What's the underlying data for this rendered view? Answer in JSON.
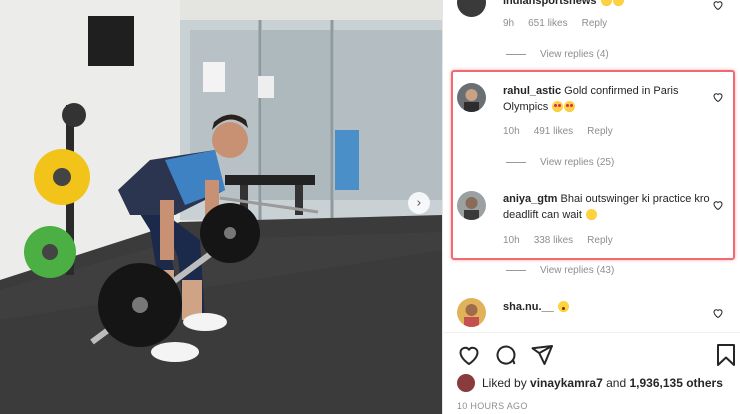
{
  "comments": [
    {
      "username": "indiansportsnews",
      "text": "",
      "emojis": [
        "hearteyes",
        "hearteyes"
      ],
      "time": "9h",
      "likes": "651 likes",
      "reply_label": "Reply",
      "view_replies": "View replies (4)"
    },
    {
      "username": "rahul_astic",
      "text": "Gold confirmed in Paris Olympics",
      "emojis": [
        "hearteyes",
        "hearteyes"
      ],
      "time": "10h",
      "likes": "491 likes",
      "reply_label": "Reply",
      "view_replies": "View replies (25)"
    },
    {
      "username": "aniya_gtm",
      "text": "Bhai outswinger ki practice kro deadlift can wait",
      "emojis": [
        "sad"
      ],
      "time": "10h",
      "likes": "338 likes",
      "reply_label": "Reply",
      "view_replies": "View replies (43)"
    },
    {
      "username": "sha.nu.__",
      "text": "",
      "emojis": [
        "wow"
      ]
    }
  ],
  "post": {
    "liked_by_prefix": "Liked by",
    "liked_by_user": "vinaykamra7",
    "liked_by_and": "and",
    "liked_by_others": "1,936,135 others",
    "timestamp": "10 HOURS AGO"
  },
  "icons": {
    "heart": "heart-outline-icon",
    "comment": "comment-bubble-icon",
    "share": "paper-plane-icon",
    "save": "bookmark-icon",
    "next": "chevron-right-icon"
  },
  "colors": {
    "highlight": "#f06a72",
    "text": "#262626",
    "muted": "#8e8e8e"
  }
}
